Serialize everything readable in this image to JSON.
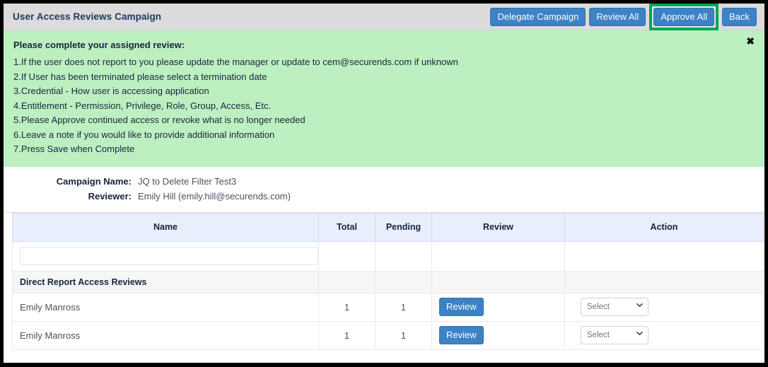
{
  "header": {
    "title": "User Access Reviews Campaign",
    "buttons": [
      {
        "label": "Delegate Campaign",
        "name": "delegate-campaign-button"
      },
      {
        "label": "Review All",
        "name": "review-all-button"
      },
      {
        "label": "Approve All",
        "name": "approve-all-button",
        "highlighted": true
      },
      {
        "label": "Back",
        "name": "back-button"
      }
    ]
  },
  "alert": {
    "title": "Please complete your assigned review:",
    "close_icon": "close-icon",
    "close_label": "✖",
    "lines": [
      "1.If the user does not report to you please update the manager or update to cem@securends.com if unknown",
      "2.If User has been terminated please select a termination date",
      "3.Credential - How user is accessing application",
      "4.Entitlement - Permission, Privilege, Role, Group, Access, Etc.",
      "5.Please Approve continued access or revoke what is no longer needed",
      "6.Leave a note if you would like to provide additional information",
      "7.Press Save when Complete"
    ]
  },
  "meta": {
    "campaign_name_label": "Campaign Name:",
    "campaign_name_value": "JQ to Delete Filter Test3",
    "reviewer_label": "Reviewer:",
    "reviewer_value": "Emily Hill (emily.hill@securends.com)"
  },
  "table": {
    "columns": [
      "Name",
      "Total",
      "Pending",
      "Review",
      "Action"
    ],
    "search_value": "",
    "search_placeholder": "",
    "group_label": "Direct Report Access Reviews",
    "rows": [
      {
        "name": "Emily Manross",
        "total": "1",
        "pending": "1",
        "review_label": "Review",
        "action_selected": "Select"
      },
      {
        "name": "Emily Manross",
        "total": "1",
        "pending": "1",
        "review_label": "Review",
        "action_selected": "Select"
      }
    ],
    "action_options": [
      "Select"
    ]
  },
  "colors": {
    "header_bar": "#dcdcdc",
    "alert_bg": "#bdf0c0",
    "button_blue": "#3c82c4",
    "highlight_green": "#00a651",
    "table_header_bg": "#e8eefb",
    "title_text": "#1f3864"
  }
}
